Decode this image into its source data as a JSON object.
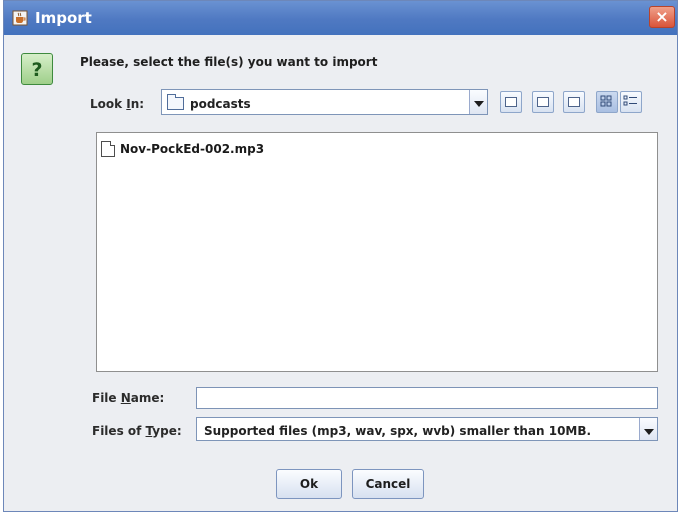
{
  "window": {
    "title": "Import",
    "close_symbol": "×"
  },
  "dialog": {
    "prompt": "Please, select the file(s) you want to import"
  },
  "look_in": {
    "label_prefix": "Look ",
    "label_hotkey": "I",
    "label_suffix": "n:",
    "value": "podcasts"
  },
  "files": [
    {
      "name": "Nov-PockEd-002.mp3"
    }
  ],
  "file_name": {
    "label_prefix": "File ",
    "label_hotkey": "N",
    "label_suffix": "ame:",
    "value": ""
  },
  "file_type": {
    "label_prefix": "Files of ",
    "label_hotkey": "T",
    "label_suffix": "ype:",
    "value": "Supported files (mp3, wav, spx, wvb) smaller than 10MB."
  },
  "buttons": {
    "ok": "Ok",
    "cancel": "Cancel"
  },
  "colors": {
    "titlebar": "#4f79c2",
    "dialog_background": "#eceef2"
  },
  "icons": {
    "title": "java-cup-icon",
    "question": "question-icon",
    "folder": "folder-icon",
    "file": "file-icon"
  }
}
